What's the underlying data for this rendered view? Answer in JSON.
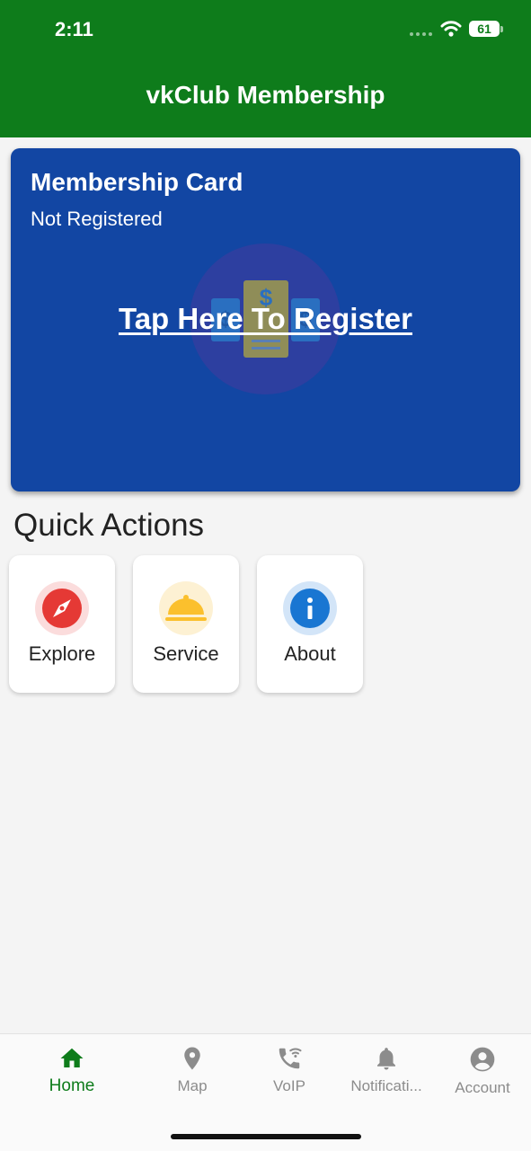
{
  "status_bar": {
    "time": "2:11",
    "battery": "61"
  },
  "header": {
    "title": "vkClub Membership"
  },
  "membership_card": {
    "title": "Membership Card",
    "status": "Not Registered",
    "cta": "Tap Here To Register",
    "background": "#1246a3"
  },
  "quick_actions": {
    "title": "Quick Actions",
    "items": [
      {
        "label": "Explore",
        "icon": "compass-icon",
        "color": "#e53935"
      },
      {
        "label": "Service",
        "icon": "service-bell-icon",
        "color": "#fbc02d"
      },
      {
        "label": "About",
        "icon": "info-icon",
        "color": "#1976d2"
      }
    ]
  },
  "bottom_nav": {
    "items": [
      {
        "label": "Home",
        "icon": "home-icon",
        "active": true
      },
      {
        "label": "Map",
        "icon": "map-pin-icon",
        "active": false
      },
      {
        "label": "VoIP",
        "icon": "wifi-calling-icon",
        "active": false
      },
      {
        "label": "Notificati...",
        "icon": "bell-icon",
        "active": false
      },
      {
        "label": "Account",
        "icon": "account-icon",
        "active": false
      }
    ]
  },
  "colors": {
    "primary": "#0e7c1b",
    "inactive": "#8c8c8c",
    "background": "#f4f4f4"
  }
}
